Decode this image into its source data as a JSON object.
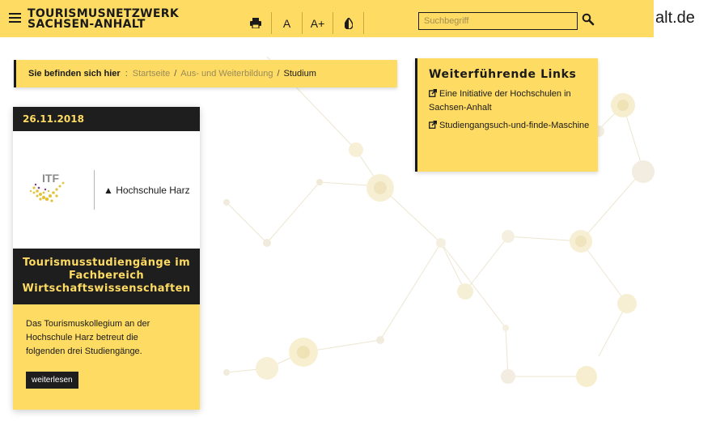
{
  "header": {
    "brand_line1": "TOURISMUSNETZWERK",
    "brand_line2": "SACHSEN-ANHALT",
    "tools": {
      "print_icon": "print-icon",
      "font_normal": "A",
      "font_larger": "A+",
      "contrast_icon": "contrast-icon"
    },
    "search": {
      "placeholder": "Suchbegriff",
      "value": ""
    },
    "domain_tail": "alt.de"
  },
  "breadcrumb": {
    "label": "Sie befinden sich hier",
    "separator": ":",
    "items": [
      "Startseite",
      "Aus- und Weiterbildung"
    ],
    "current": "Studium"
  },
  "links_box": {
    "title": "Weiterführende Links",
    "links": [
      "Eine Initiative der Hochschulen in Sachsen-Anhalt",
      "Studiengangsuch-und-finde-Maschine"
    ]
  },
  "card": {
    "date": "26.11.2018",
    "image_logos": {
      "itf": "ITF",
      "hochschule": "▲ Hochschule Harz"
    },
    "title": "Tourismusstudiengänge im Fachbereich Wirtschaftswissenschaften",
    "text": "Das Tourismuskollegium an der Hochschule Harz betreut die folgenden drei Studiengänge.",
    "read_more": "weiterlesen"
  },
  "colors": {
    "brand_yellow": "#fedb62",
    "dark": "#1e1e1e"
  }
}
